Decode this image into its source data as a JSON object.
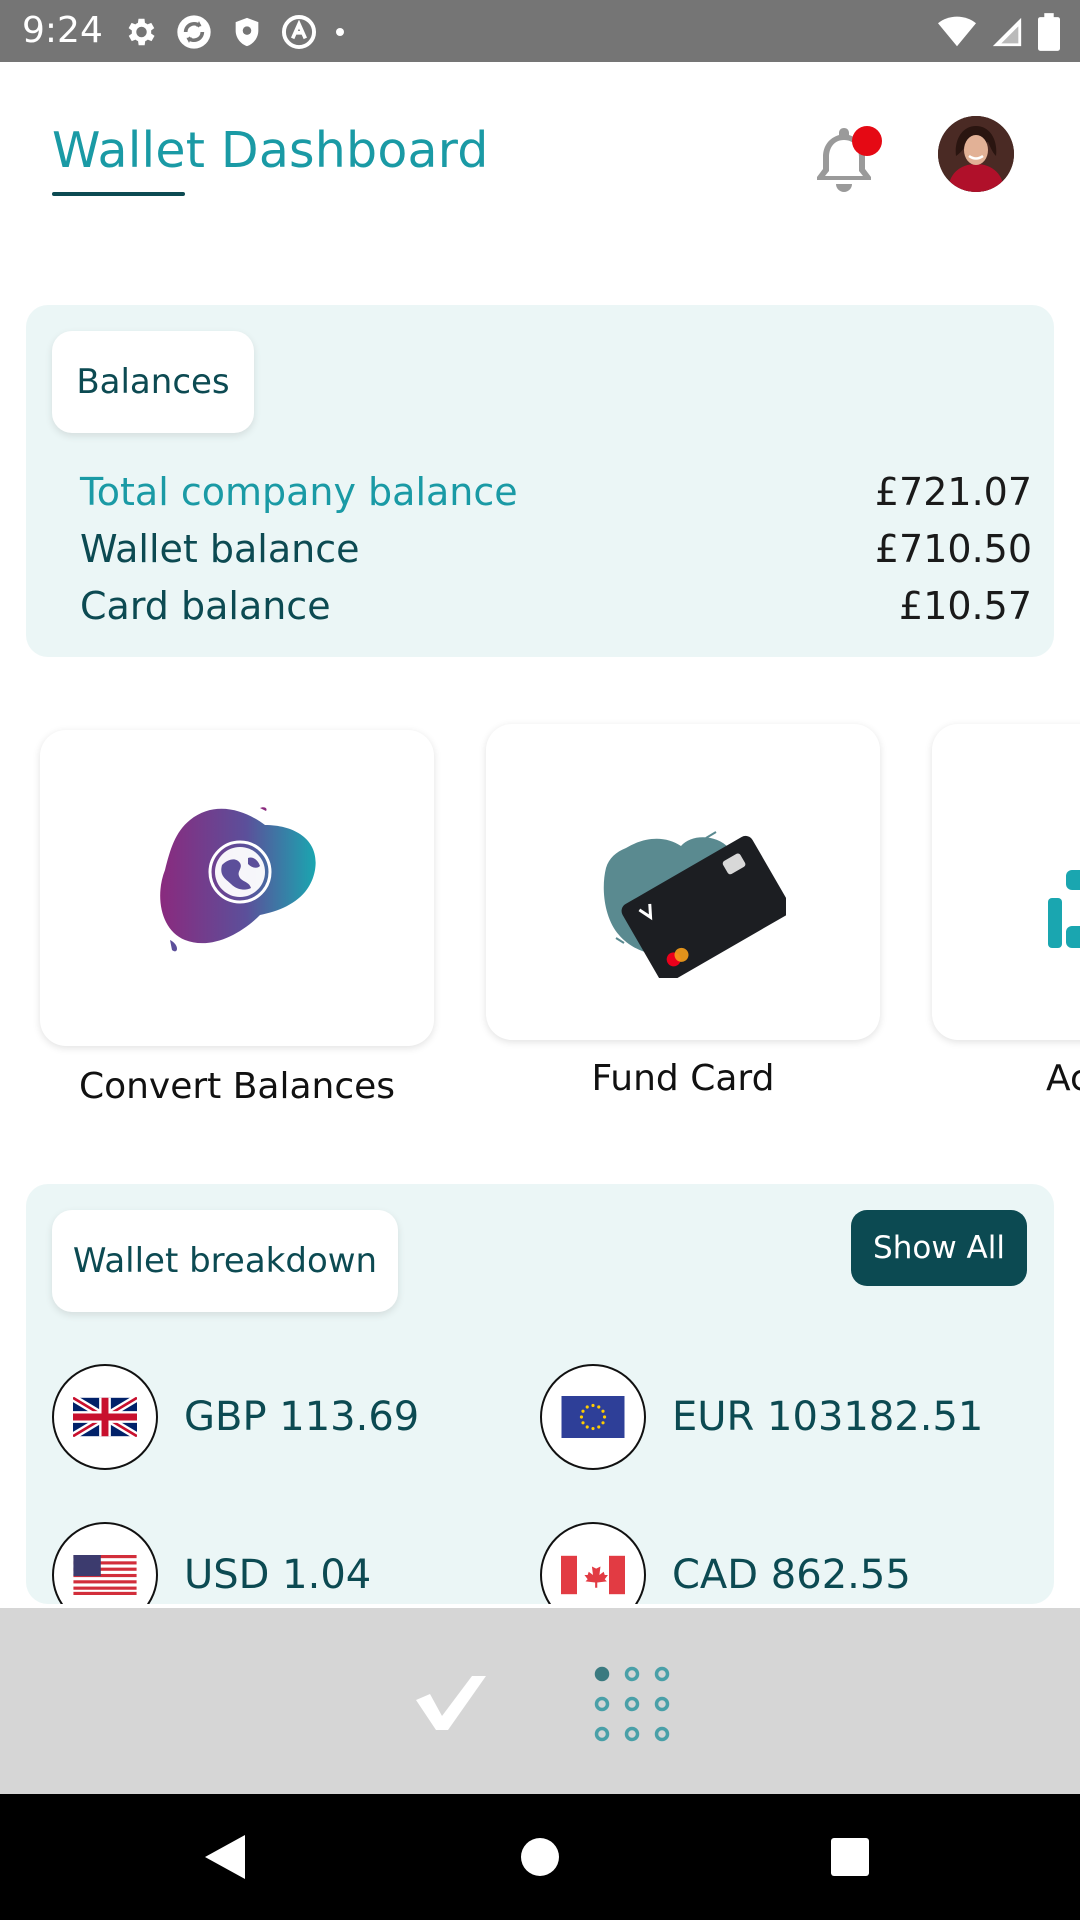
{
  "status_bar": {
    "time": "9:24",
    "left_icons": [
      "gear-icon",
      "sync-icon",
      "shield-icon",
      "at-sign-icon",
      "dot-icon"
    ],
    "right_icons": [
      "wifi-icon",
      "cellular-signal-icon",
      "battery-icon"
    ]
  },
  "header": {
    "title": "Wallet Dashboard",
    "notification_icon": "bell-icon",
    "has_unread_notification": true,
    "notification_dot_color": "#e50914"
  },
  "balances": {
    "section_label": "Balances",
    "rows": [
      {
        "label": "Total company balance",
        "value": "£721.07"
      },
      {
        "label": "Wallet balance",
        "value": "£710.50"
      },
      {
        "label": "Card balance",
        "value": "£10.57"
      }
    ]
  },
  "actions": [
    {
      "label": "Convert Balances",
      "icon": "globe-icon"
    },
    {
      "label": "Fund Card",
      "icon": "card-icon"
    },
    {
      "label": "Ac",
      "icon": "partial-tile-icon"
    }
  ],
  "wallet_breakdown": {
    "section_label": "Wallet breakdown",
    "show_all_label": "Show All",
    "currencies": [
      {
        "code": "GBP",
        "text": "GBP 113.69",
        "flag": "uk-flag-icon"
      },
      {
        "code": "EUR",
        "text": "EUR 103182.51",
        "flag": "eu-flag-icon"
      },
      {
        "code": "USD",
        "text": "USD 1.04",
        "flag": "us-flag-icon"
      },
      {
        "code": "CAD",
        "text": "CAD 862.55",
        "flag": "canada-flag-icon"
      }
    ]
  },
  "bottom_bar": {
    "logo_icon": "app-logo-icon",
    "menu_icon": "grid-menu-icon"
  },
  "nav_bar": {
    "back_icon": "back-icon",
    "home_icon": "home-icon",
    "recents_icon": "recents-icon"
  },
  "colors": {
    "accent": "#1a9aa5",
    "dark_teal": "#0c4a52",
    "card_bg": "#ebf6f6",
    "status_bar": "#757575",
    "bottom_bar": "#d6d6d6"
  }
}
